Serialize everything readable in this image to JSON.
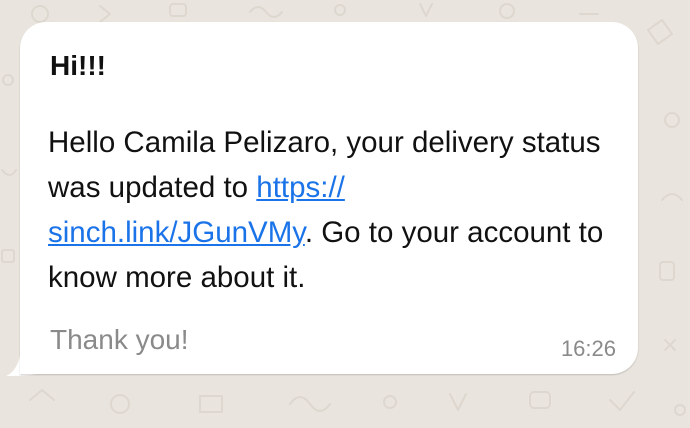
{
  "message": {
    "header": "Hi!!!",
    "body_before_link": "Hello Camila Pelizaro, your delivery status was updated to ",
    "link_line1": "https://",
    "link_line2": "sinch.link/JGunVMy",
    "link_url": "https://sinch.link/JGunVMy",
    "body_after_link": ". Go to your account to know more about it.",
    "footer": "Thank you!",
    "time": "16:26"
  },
  "colors": {
    "background": "#e9e4dd",
    "bubble": "#ffffff",
    "link": "#1a73e8",
    "meta_text": "#8a8a8a"
  },
  "icons": [
    "chat-wallpaper-doodles"
  ]
}
